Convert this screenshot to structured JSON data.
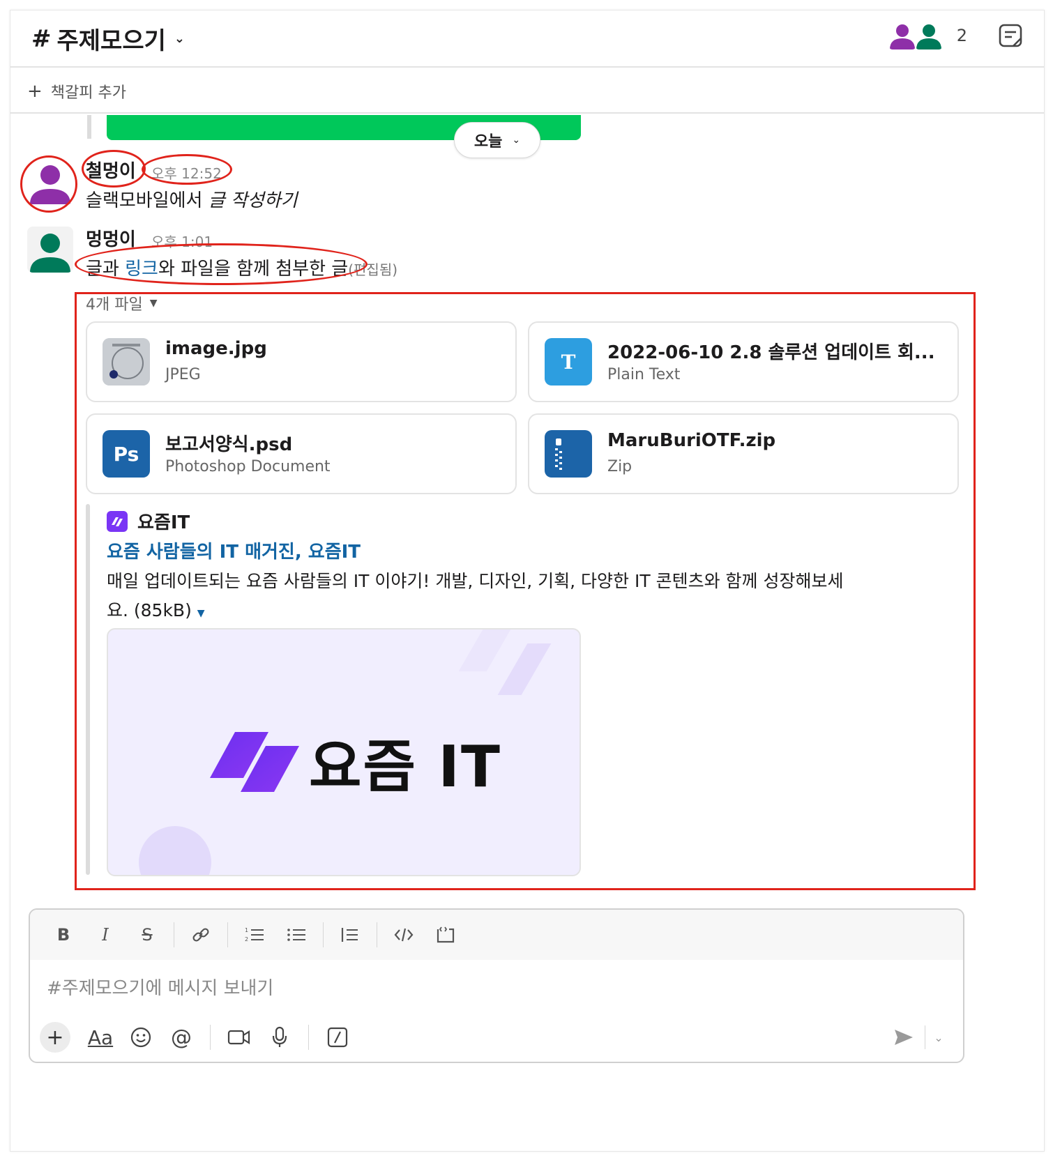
{
  "channel": {
    "hash": "#",
    "name": "주제모으기",
    "member_count": "2"
  },
  "bookmark": {
    "add_label": "책갈피 추가"
  },
  "date_divider": {
    "label": "오늘"
  },
  "messages": [
    {
      "author": "철멍이",
      "time": "오후 12:52",
      "text_plain": "슬랙모바일에서 ",
      "text_italic": "글 작성하기",
      "avatar_color": "#8e2fa8"
    },
    {
      "author": "멍멍이",
      "time": "오후 1:01",
      "text_before": "글과 ",
      "text_link": "링크",
      "text_after": "와 파일을 함께 첨부한 글",
      "edited": "(편집됨)",
      "avatar_color": "#007a5a"
    }
  ],
  "files": {
    "toggle_label": "4개 파일",
    "items": [
      {
        "name": "image.jpg",
        "type": "JPEG",
        "icon": "image-thumbnail"
      },
      {
        "name": "2022-06-10 2.8 솔루션 업데이트 회...",
        "type": "Plain Text",
        "icon": "text-file-icon",
        "icon_letter": "T",
        "color": "#2d9ee0"
      },
      {
        "name": "보고서양식.psd",
        "type": "Photoshop Document",
        "icon": "photoshop-icon",
        "icon_letter": "Ps",
        "color": "#1c64a8"
      },
      {
        "name": "MaruBuriOTF.zip",
        "type": "Zip",
        "icon": "zip-icon",
        "color": "#1c64a8"
      }
    ]
  },
  "unfurl": {
    "site_name": "요즘IT",
    "title": "요즘 사람들의 IT 매거진, 요즘IT",
    "description": "매일 업데이트되는 요즘 사람들의 IT 이야기! 개발, 디자인, 기획, 다양한 IT 콘텐츠와 함께 성장해보세요. (85kB)",
    "preview_logo_text": "요즘 IT"
  },
  "composer": {
    "placeholder": "#주제모으기에 메시지 보내기",
    "format_label": "Aa"
  },
  "colors": {
    "accent_red": "#e0231b",
    "link": "#1264a3",
    "green_bar": "#00c85a"
  }
}
